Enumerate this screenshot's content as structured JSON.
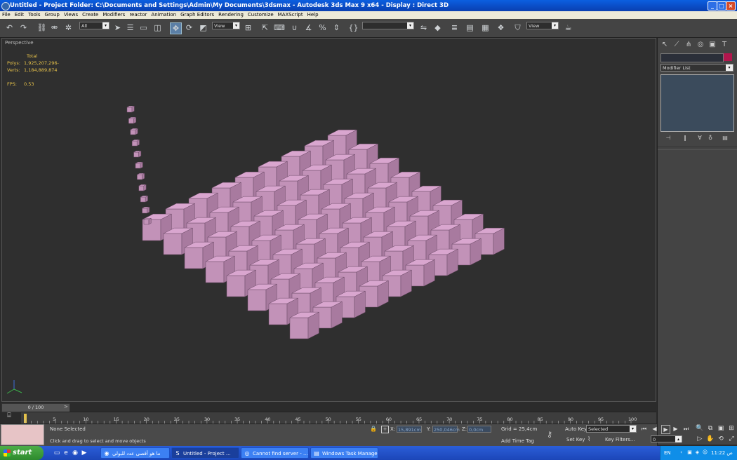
{
  "window": {
    "title": "Untitled     - Project Folder: C:\\Documents and Settings\\Admin\\My Documents\\3dsmax    - Autodesk 3ds Max 9 x64     - Display : Direct 3D"
  },
  "menu": [
    "File",
    "Edit",
    "Tools",
    "Group",
    "Views",
    "Create",
    "Modifiers",
    "reactor",
    "Animation",
    "Graph Editors",
    "Rendering",
    "Customize",
    "MAXScript",
    "Help"
  ],
  "toolbar": {
    "selection_filter": "All",
    "ref_coord": "View",
    "named_selection": "",
    "render_view": "View"
  },
  "viewport": {
    "label": "Perspective",
    "stats": {
      "header": "Total",
      "polys_label": "Polys:",
      "polys_value": "1,925,207,296-",
      "verts_label": "Verts:",
      "verts_value": "1,184,889,874",
      "fps_label": "FPS:",
      "fps_value": "0.53"
    },
    "object_color": "#d9a6cf"
  },
  "command_panel": {
    "modifier_list": "Modifier List",
    "object_color": "#b2164d"
  },
  "timeline": {
    "slider": "0 / 100",
    "ticks": [
      "5",
      "10",
      "15",
      "20",
      "25",
      "30",
      "35",
      "40",
      "45",
      "50",
      "55",
      "60",
      "65",
      "70",
      "75",
      "80",
      "85",
      "90",
      "95",
      "100"
    ]
  },
  "status": {
    "selection": "None Selected",
    "prompt": "Click and drag to select and move objects",
    "x_label": "X:",
    "x_value": "15,891cm",
    "y_label": "Y:",
    "y_value": "250,046cm",
    "z_label": "Z:",
    "z_value": "0,0cm",
    "grid": "Grid = 25,4cm",
    "add_time_tag": "Add Time Tag",
    "auto_key": "Auto Key",
    "key_mode": "Selected",
    "set_key": "Set Key",
    "key_filters": "Key Filters...",
    "frame": "0"
  },
  "taskbar": {
    "start": "start",
    "tasks": [
      {
        "label": "ما هو أقصى عدد للبولي"
      },
      {
        "label": "Untitled     - Project ..."
      },
      {
        "label": "Cannot find server - ..."
      },
      {
        "label": "Windows Task Manager"
      }
    ],
    "lang": "EN",
    "clock": "11:22 ص"
  }
}
